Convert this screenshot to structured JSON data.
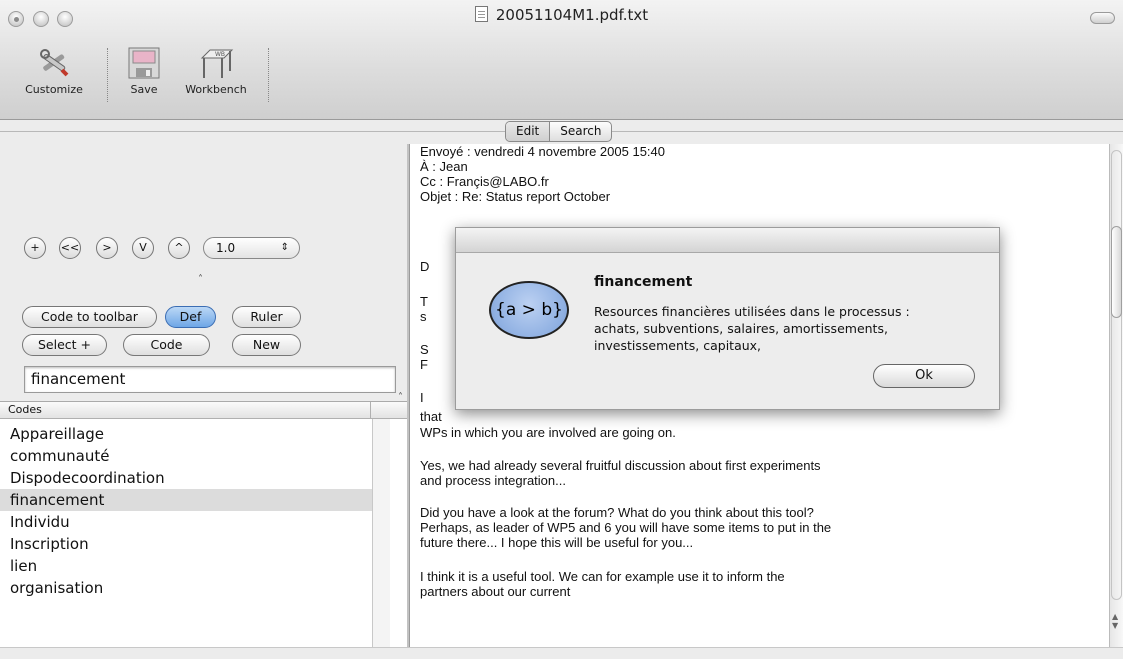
{
  "window": {
    "title": "20051104M1.pdf.txt"
  },
  "toolbar": {
    "customize_label": "Customize",
    "save_label": "Save",
    "workbench_label": "Workbench"
  },
  "mode_switch": {
    "edit_label": "Edit",
    "search_label": "Search",
    "selected": "Edit"
  },
  "nav_controls": {
    "plus": "+",
    "prev": "<<",
    "next": ">",
    "down": "V",
    "up": "^",
    "zoom_value": "1.0",
    "zoom_arrows": "⇕"
  },
  "code_buttons": {
    "code_to_toolbar": "Code to toolbar",
    "def": "Def",
    "ruler": "Ruler",
    "select_plus": "Select +",
    "code": "Code",
    "new": "New"
  },
  "search": {
    "value": "financement"
  },
  "codes": {
    "header": "Codes",
    "items": [
      "Appareillage",
      "communauté",
      "Dispodecoordination",
      "financement",
      "Individu",
      "Inscription",
      "lien",
      "organisation"
    ],
    "selected": "financement"
  },
  "document": {
    "lines": [
      "Envoyé : vendredi 4 novembre 2005 15:40",
      "À : Jean",
      "Cc : Françis@LABO.fr",
      "Objet : Re: Status report October",
      "D",
      "T",
      "s",
      "S",
      "F",
      "I",
      "that",
      " WPs in which you are involved are going on.",
      "Yes, we had already several fruitful discussion about first experiments",
      "and process integration...",
      " Did you have a look at the forum? What do you think about this tool?",
      " Perhaps, as leader of WP5 and 6 you will have some items to put in the",
      " future there... I hope this will be useful for you...",
      "I think it is a useful tool. We can for example use it to inform the",
      "partners about our current"
    ]
  },
  "dialog": {
    "icon_text": "{a > b}",
    "title": "financement",
    "message_lines": [
      "Resources financières utilisées dans le processus :",
      "achats, subventions, salaires, amortissements,",
      "investissements, capitaux,"
    ],
    "ok_label": "Ok"
  }
}
